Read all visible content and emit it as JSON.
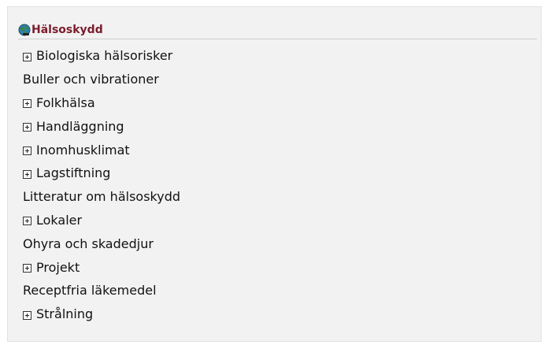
{
  "section": {
    "title": "Hälsoskydd",
    "icon": "globe-icon",
    "title_color": "#7b1c2c"
  },
  "items": [
    {
      "label": "Biologiska hälsorisker",
      "expandable": true
    },
    {
      "label": "Buller och vibrationer",
      "expandable": false
    },
    {
      "label": "Folkhälsa",
      "expandable": true
    },
    {
      "label": "Handläggning",
      "expandable": true
    },
    {
      "label": "Inomhusklimat",
      "expandable": true
    },
    {
      "label": "Lagstiftning",
      "expandable": true
    },
    {
      "label": "Litteratur om hälsoskydd",
      "expandable": false
    },
    {
      "label": "Lokaler",
      "expandable": true
    },
    {
      "label": "Ohyra och skadedjur",
      "expandable": false
    },
    {
      "label": "Projekt",
      "expandable": true
    },
    {
      "label": "Receptfria läkemedel",
      "expandable": false
    },
    {
      "label": "Strålning",
      "expandable": true
    }
  ]
}
